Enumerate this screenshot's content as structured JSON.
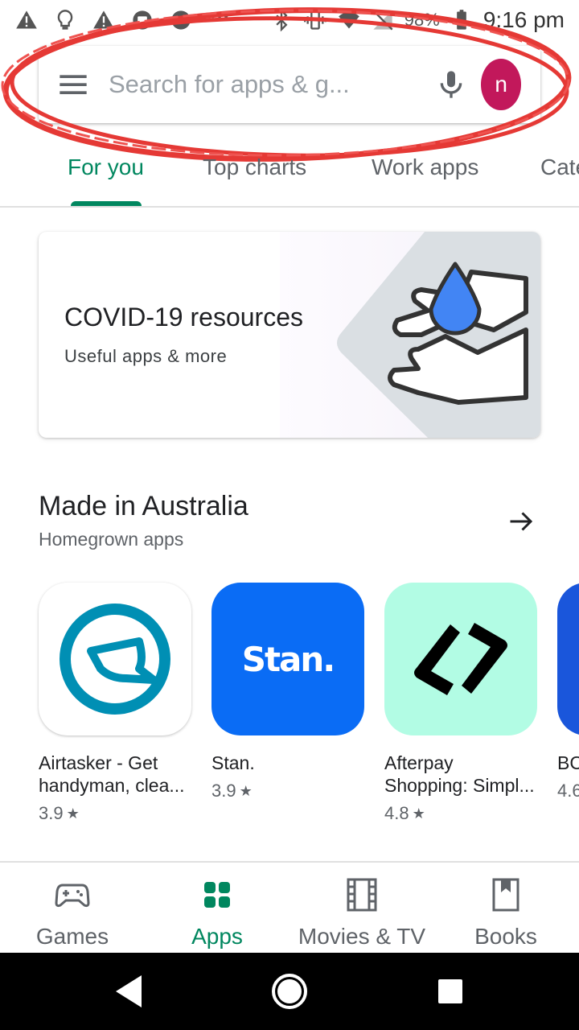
{
  "status_bar": {
    "icons": [
      "warning-icon",
      "lightbulb-icon",
      "warning-icon",
      "cast-icon",
      "sync-icon",
      "more-icon",
      "bluetooth-icon",
      "vibrate-icon",
      "wifi-icon",
      "no-signal-icon",
      "battery-icon"
    ],
    "battery": "98%",
    "time": "9:16 pm"
  },
  "search": {
    "placeholder": "Search for apps & g...",
    "avatar_letter": "n",
    "avatar_color": "#c2185b"
  },
  "tabs": [
    {
      "label": "For you",
      "active": true
    },
    {
      "label": "Top charts",
      "active": false
    },
    {
      "label": "Work apps",
      "active": false
    },
    {
      "label": "Cate",
      "active": false
    }
  ],
  "banner": {
    "title": "COVID-19 resources",
    "subtitle": "Useful apps & more"
  },
  "section": {
    "title": "Made in Australia",
    "subtitle": "Homegrown apps"
  },
  "apps": [
    {
      "name_line1": "Airtasker - Get",
      "name_line2": "handyman, clea...",
      "rating": "3.9",
      "icon": "airtasker-icon"
    },
    {
      "name_line1": "Stan.",
      "name_line2": "",
      "rating": "3.9",
      "icon": "stan-icon",
      "icon_text": "Stan."
    },
    {
      "name_line1": "Afterpay",
      "name_line2": "Shopping: Simpl...",
      "rating": "4.8",
      "icon": "afterpay-icon"
    },
    {
      "name_line1": "BC",
      "name_line2": "",
      "rating": "4.6",
      "icon": "partial-app-icon"
    }
  ],
  "bottom_nav": [
    {
      "label": "Games",
      "icon": "gamepad-icon",
      "active": false
    },
    {
      "label": "Apps",
      "icon": "apps-grid-icon",
      "active": true
    },
    {
      "label": "Movies & TV",
      "icon": "film-icon",
      "active": false
    },
    {
      "label": "Books",
      "icon": "bookmark-book-icon",
      "active": false
    }
  ],
  "colors": {
    "accent": "#01875f",
    "annotation": "#e53935",
    "stan_blue": "#0a6cf5",
    "afterpay_mint": "#b2fce4",
    "airtasker_blue": "#008fb4"
  }
}
